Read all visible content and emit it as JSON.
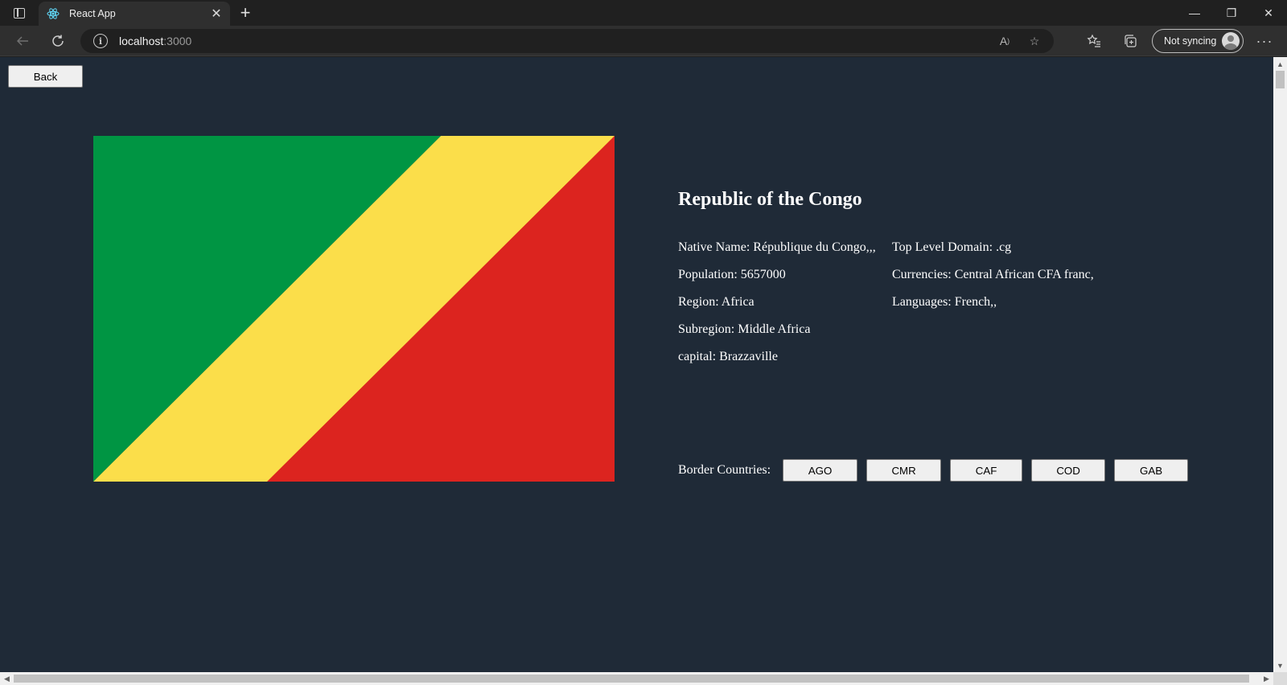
{
  "browser": {
    "tab_title": "React App",
    "new_tab_symbol": "+",
    "close_tab_symbol": "✕",
    "url_host": "localhost",
    "url_port": ":3000",
    "sync_label": "Not syncing",
    "window_controls": {
      "minimize": "—",
      "restore": "❐",
      "close": "✕"
    },
    "menu_symbol": "···"
  },
  "page": {
    "back_label": "Back",
    "country": {
      "name": "Republic of the Congo",
      "left_info": [
        "Native Name: République du Congo,,,",
        "Population: 5657000",
        "Region: Africa",
        "Subregion: Middle Africa",
        "capital: Brazzaville"
      ],
      "right_info": [
        "Top Level Domain: .cg",
        "Currencies: Central African CFA franc,",
        "Languages: French,,"
      ],
      "border_label": "Border Countries:",
      "borders": [
        "AGO",
        "CMR",
        "CAF",
        "COD",
        "GAB"
      ]
    },
    "flag_colors": {
      "green": "#009543",
      "yellow": "#fbde4a",
      "red": "#dc241f"
    },
    "background_color": "#1f2a37"
  },
  "icons": [
    "tab-actions-icon",
    "react-logo-icon",
    "back-arrow-icon",
    "refresh-icon",
    "site-info-icon",
    "read-aloud-icon",
    "add-favorite-icon",
    "favorites-icon",
    "collections-icon",
    "profile-avatar-icon",
    "more-menu-icon"
  ]
}
